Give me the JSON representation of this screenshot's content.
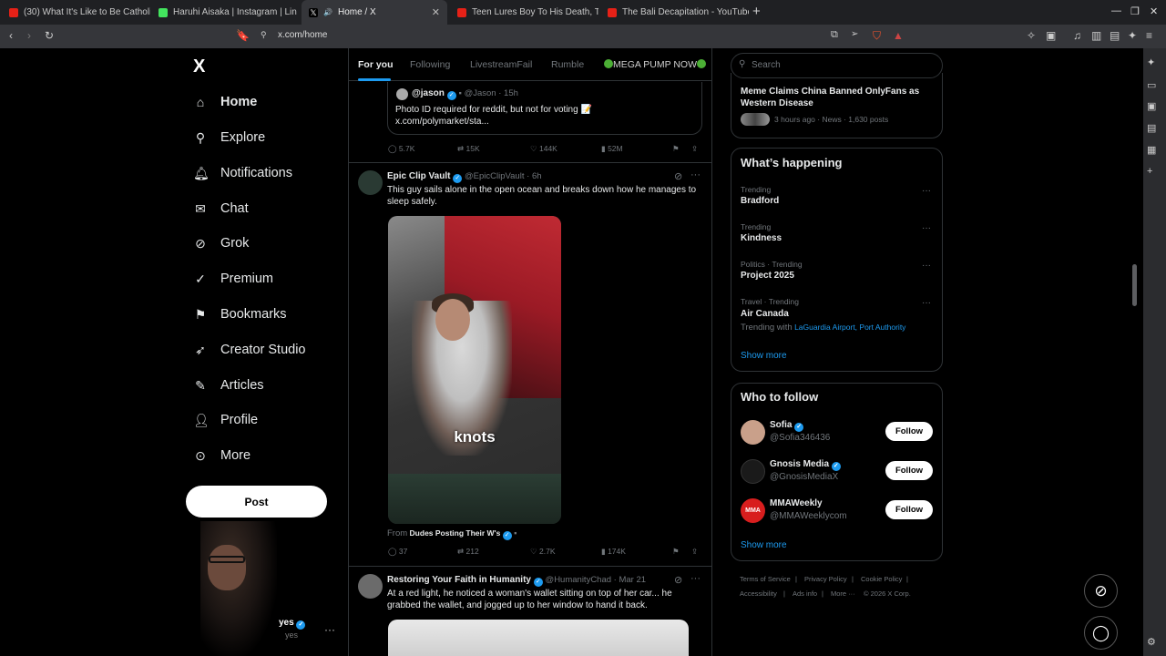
{
  "browser": {
    "tabs": [
      {
        "label": "(30) What It's Like to Be Catholic",
        "icon": "youtube-icon",
        "color": "#e62117"
      },
      {
        "label": "Haruhi Aisaka | Instagram | Lin",
        "icon": "linktree-icon",
        "color": "#43e55e"
      },
      {
        "label": "Home / X",
        "icon": "x-icon",
        "color": "#ffffff"
      },
      {
        "label": "Teen Lures Boy To His Death, Th",
        "icon": "youtube-icon",
        "color": "#e62117"
      },
      {
        "label": "The Bali Decapitation - YouTube",
        "icon": "youtube-icon",
        "color": "#e62117"
      }
    ],
    "url": "x.com/home"
  },
  "nav": {
    "logo": "X",
    "items": [
      {
        "label": "Home",
        "icon": "home-icon"
      },
      {
        "label": "Explore",
        "icon": "search-icon"
      },
      {
        "label": "Notifications",
        "icon": "bell-icon"
      },
      {
        "label": "Chat",
        "icon": "mail-icon"
      },
      {
        "label": "Grok",
        "icon": "grok-icon"
      },
      {
        "label": "Premium",
        "icon": "premium-icon"
      },
      {
        "label": "Bookmarks",
        "icon": "bookmark-icon"
      },
      {
        "label": "Creator Studio",
        "icon": "rocket-icon"
      },
      {
        "label": "Articles",
        "icon": "article-icon"
      },
      {
        "label": "Profile",
        "icon": "person-icon"
      },
      {
        "label": "More",
        "icon": "more-circle-icon"
      }
    ],
    "post_label": "Post",
    "account_name_partial": "yes",
    "account_handle_partial": "yes"
  },
  "timeline": {
    "tabs": [
      "For you",
      "Following",
      "LivestreamFail",
      "Rumble",
      "MEGA PUMP NOW"
    ],
    "quote": {
      "name": "@jason",
      "handle": "@Jason",
      "time": "15h",
      "text1": "Photo ID required for reddit, but not for voting 📝",
      "text2": "x.com/polymarket/sta..."
    },
    "post1_stats": {
      "replies": "5.7K",
      "reposts": "15K",
      "likes": "144K",
      "views": "52M"
    },
    "post2": {
      "name": "Epic Clip Vault",
      "handle": "@EpicClipVault",
      "time": "6h",
      "text": "This guy sails alone in the open ocean and breaks down how he manages to sleep safely.",
      "caption": "knots",
      "from_prefix": "From",
      "from_source": "Dudes Posting Their W's",
      "stats": {
        "replies": "37",
        "reposts": "212",
        "likes": "2.7K",
        "views": "174K"
      }
    },
    "post3": {
      "name": "Restoring Your Faith in Humanity",
      "handle": "@HumanityChad",
      "time": "Mar 21",
      "text": "At a red light, he noticed a woman's wallet sitting on top of her car... he grabbed the wallet, and jogged up to her window to hand it back."
    }
  },
  "sidebar": {
    "search_placeholder": "Search",
    "top_trend": {
      "title": "Meme Claims China Banned OnlyFans as Western Disease",
      "meta": "3 hours ago · News · 1,630 posts"
    },
    "happening_title": "What’s happening",
    "trends": [
      {
        "label": "Trending",
        "name": "Bradford"
      },
      {
        "label": "Trending",
        "name": "Kindness"
      },
      {
        "label": "Politics · Trending",
        "name": "Project 2025"
      },
      {
        "label": "Travel · Trending",
        "name": "Air Canada",
        "with_prefix": "Trending with",
        "with": "LaGuardia Airport, Port Authority"
      }
    ],
    "show_more": "Show more",
    "wtf_title": "Who to follow",
    "follow": [
      {
        "name": "Sofia",
        "handle": "@Sofia346436",
        "button": "Follow"
      },
      {
        "name": "Gnosis Media",
        "handle": "@GnosisMediaX",
        "button": "Follow"
      },
      {
        "name": "MMAWeekly",
        "handle": "@MMAWeeklycom",
        "button": "Follow"
      }
    ],
    "wtf_show_more": "Show more",
    "footer": {
      "terms": "Terms of Service",
      "privacy": "Privacy Policy",
      "cookie": "Cookie Policy",
      "accessibility": "Accessibility",
      "ads": "Ads info",
      "more": "More ···",
      "copyright": "© 2026 X Corp."
    }
  },
  "colors": {
    "accent": "#1d9bf0",
    "background": "#000000",
    "border": "#2f3336"
  }
}
